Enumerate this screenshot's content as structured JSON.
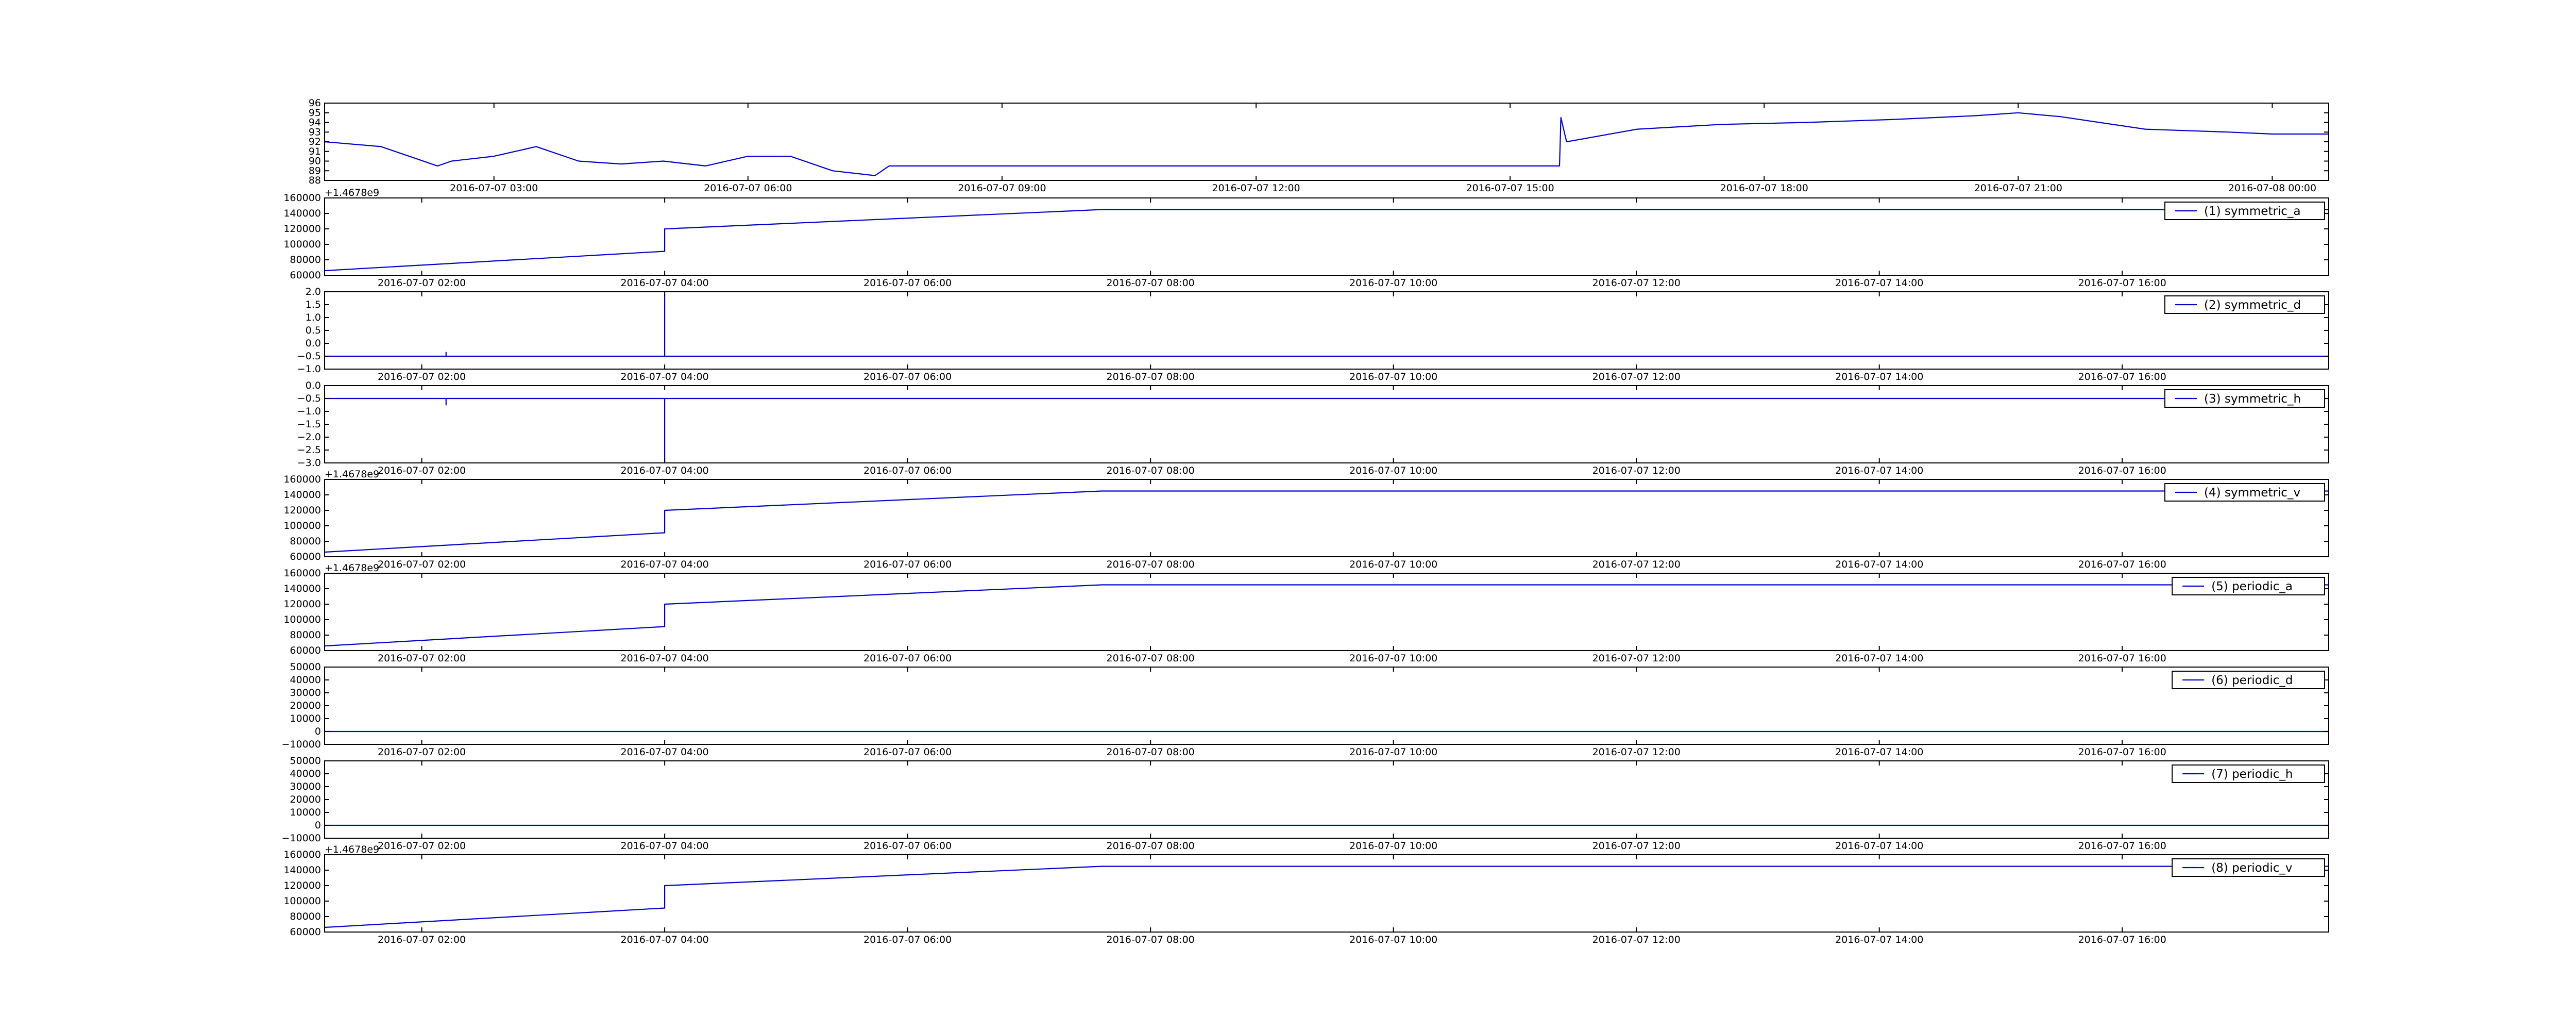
{
  "chart_data": [
    {
      "id": "top",
      "type": "line",
      "series": [
        {
          "color": "#0000cc",
          "x": [
            "2016-07-07 01:00",
            "2016-07-07 01:40",
            "2016-07-07 02:20",
            "2016-07-07 02:30",
            "2016-07-07 03:00",
            "2016-07-07 03:30",
            "2016-07-07 04:00",
            "2016-07-07 04:30",
            "2016-07-07 05:00",
            "2016-07-07 05:30",
            "2016-07-07 06:00",
            "2016-07-07 06:30",
            "2016-07-07 07:00",
            "2016-07-07 07:30",
            "2016-07-07 07:40",
            "2016-07-07 15:35",
            "2016-07-07 15:36",
            "2016-07-07 15:40",
            "2016-07-07 16:30",
            "2016-07-07 17:30",
            "2016-07-07 18:30",
            "2016-07-07 19:30",
            "2016-07-07 20:30",
            "2016-07-07 21:00",
            "2016-07-07 21:30",
            "2016-07-07 22:30",
            "2016-07-07 23:30",
            "2016-07-08 00:00",
            "2016-07-08 00:40"
          ],
          "y": [
            92,
            91.5,
            89.5,
            90,
            90.5,
            91.5,
            90,
            89.7,
            90,
            89.5,
            90.5,
            90.5,
            89,
            88.5,
            89.5,
            89.5,
            94.5,
            92,
            93.3,
            93.8,
            94,
            94.3,
            94.7,
            95,
            94.6,
            93.3,
            93,
            92.8,
            92.8
          ]
        }
      ],
      "xlim": [
        "2016-07-07 01:00",
        "2016-07-08 00:40"
      ],
      "ylim": [
        88,
        96
      ],
      "yticks": [
        "88",
        "89",
        "90",
        "91",
        "92",
        "93",
        "94",
        "95",
        "96"
      ],
      "xticks": [
        "2016-07-07 03:00",
        "2016-07-07 06:00",
        "2016-07-07 09:00",
        "2016-07-07 12:00",
        "2016-07-07 15:00",
        "2016-07-07 18:00",
        "2016-07-07 21:00",
        "2016-07-08 00:00"
      ],
      "offset": "",
      "legend": ""
    },
    {
      "id": "symmetric_a",
      "type": "line",
      "series": [
        {
          "color": "#0000cc",
          "x": [
            1.2,
            4.0,
            4.0,
            7.6,
            17.7
          ],
          "y": [
            66000,
            91000,
            120000,
            145000,
            145000
          ]
        }
      ],
      "xlim": [
        1.2,
        17.7
      ],
      "ylim": [
        60000,
        160000
      ],
      "yticks": [
        "60000",
        "80000",
        "100000",
        "120000",
        "140000",
        "160000"
      ],
      "xticks": [
        "2016-07-07 02:00",
        "2016-07-07 04:00",
        "2016-07-07 06:00",
        "2016-07-07 08:00",
        "2016-07-07 10:00",
        "2016-07-07 12:00",
        "2016-07-07 14:00",
        "2016-07-07 16:00"
      ],
      "offset": "+1.4678e9",
      "legend": "(1) symmetric_a"
    },
    {
      "id": "symmetric_d",
      "type": "line",
      "series": [
        {
          "color": "#0000cc",
          "x": [
            1.2,
            2.2,
            2.2,
            2.2,
            4.0,
            4.0,
            4.0,
            17.7
          ],
          "y": [
            -0.5,
            -0.5,
            -0.35,
            -0.5,
            -0.5,
            1.9,
            -0.5,
            -0.5
          ]
        }
      ],
      "xlim": [
        1.2,
        17.7
      ],
      "ylim": [
        -1.0,
        2.0
      ],
      "yticks": [
        "−1.0",
        "−0.5",
        "0.0",
        "0.5",
        "1.0",
        "1.5",
        "2.0"
      ],
      "xticks": [
        "2016-07-07 02:00",
        "2016-07-07 04:00",
        "2016-07-07 06:00",
        "2016-07-07 08:00",
        "2016-07-07 10:00",
        "2016-07-07 12:00",
        "2016-07-07 14:00",
        "2016-07-07 16:00"
      ],
      "offset": "",
      "legend": "(2) symmetric_d"
    },
    {
      "id": "symmetric_h",
      "type": "line",
      "series": [
        {
          "color": "#0000cc",
          "x": [
            1.2,
            2.2,
            2.2,
            2.2,
            4.0,
            4.0,
            4.0,
            17.7
          ],
          "y": [
            -0.5,
            -0.5,
            -0.75,
            -0.5,
            -0.5,
            -2.95,
            -0.5,
            -0.5
          ]
        }
      ],
      "xlim": [
        1.2,
        17.7
      ],
      "ylim": [
        -3.0,
        0.0
      ],
      "yticks": [
        "−3.0",
        "−2.5",
        "−2.0",
        "−1.5",
        "−1.0",
        "−0.5",
        "0.0"
      ],
      "xticks": [
        "2016-07-07 02:00",
        "2016-07-07 04:00",
        "2016-07-07 06:00",
        "2016-07-07 08:00",
        "2016-07-07 10:00",
        "2016-07-07 12:00",
        "2016-07-07 14:00",
        "2016-07-07 16:00"
      ],
      "offset": "",
      "legend": "(3) symmetric_h"
    },
    {
      "id": "symmetric_v",
      "type": "line",
      "series": [
        {
          "color": "#0000cc",
          "x": [
            1.2,
            4.0,
            4.0,
            7.6,
            17.7
          ],
          "y": [
            66000,
            91000,
            120000,
            145000,
            145000
          ]
        }
      ],
      "xlim": [
        1.2,
        17.7
      ],
      "ylim": [
        60000,
        160000
      ],
      "yticks": [
        "60000",
        "80000",
        "100000",
        "120000",
        "140000",
        "160000"
      ],
      "xticks": [
        "2016-07-07 02:00",
        "2016-07-07 04:00",
        "2016-07-07 06:00",
        "2016-07-07 08:00",
        "2016-07-07 10:00",
        "2016-07-07 12:00",
        "2016-07-07 14:00",
        "2016-07-07 16:00"
      ],
      "offset": "+1.4678e9",
      "legend": "(4) symmetric_v"
    },
    {
      "id": "periodic_a",
      "type": "line",
      "series": [
        {
          "color": "#0000cc",
          "x": [
            1.2,
            4.0,
            4.0,
            7.6,
            17.7
          ],
          "y": [
            66000,
            91000,
            120000,
            145000,
            145000
          ]
        }
      ],
      "xlim": [
        1.2,
        17.7
      ],
      "ylim": [
        60000,
        160000
      ],
      "yticks": [
        "60000",
        "80000",
        "100000",
        "120000",
        "140000",
        "160000"
      ],
      "xticks": [
        "2016-07-07 02:00",
        "2016-07-07 04:00",
        "2016-07-07 06:00",
        "2016-07-07 08:00",
        "2016-07-07 10:00",
        "2016-07-07 12:00",
        "2016-07-07 14:00",
        "2016-07-07 16:00"
      ],
      "offset": "+1.4678e9",
      "legend": "(5) periodic_a"
    },
    {
      "id": "periodic_d",
      "type": "line",
      "series": [
        {
          "color": "#0000cc",
          "x": [
            1.2,
            17.7
          ],
          "y": [
            0,
            0
          ]
        }
      ],
      "xlim": [
        1.2,
        17.7
      ],
      "ylim": [
        -10000,
        50000
      ],
      "yticks": [
        "−10000",
        "0",
        "10000",
        "20000",
        "30000",
        "40000",
        "50000"
      ],
      "xticks": [
        "2016-07-07 02:00",
        "2016-07-07 04:00",
        "2016-07-07 06:00",
        "2016-07-07 08:00",
        "2016-07-07 10:00",
        "2016-07-07 12:00",
        "2016-07-07 14:00",
        "2016-07-07 16:00"
      ],
      "offset": "",
      "legend": "(6) periodic_d"
    },
    {
      "id": "periodic_h",
      "type": "line",
      "series": [
        {
          "color": "#0000cc",
          "x": [
            1.2,
            17.7
          ],
          "y": [
            0,
            0
          ]
        }
      ],
      "xlim": [
        1.2,
        17.7
      ],
      "ylim": [
        -10000,
        50000
      ],
      "yticks": [
        "−10000",
        "0",
        "10000",
        "20000",
        "30000",
        "40000",
        "50000"
      ],
      "xticks": [
        "2016-07-07 02:00",
        "2016-07-07 04:00",
        "2016-07-07 06:00",
        "2016-07-07 08:00",
        "2016-07-07 10:00",
        "2016-07-07 12:00",
        "2016-07-07 14:00",
        "2016-07-07 16:00"
      ],
      "offset": "",
      "legend": "(7) periodic_h"
    },
    {
      "id": "periodic_v",
      "type": "line",
      "series": [
        {
          "color": "#0000cc",
          "x": [
            1.2,
            4.0,
            4.0,
            7.6,
            17.7
          ],
          "y": [
            66000,
            91000,
            120000,
            145000,
            145000
          ]
        }
      ],
      "xlim": [
        1.2,
        17.7
      ],
      "ylim": [
        60000,
        160000
      ],
      "yticks": [
        "60000",
        "80000",
        "100000",
        "120000",
        "140000",
        "160000"
      ],
      "xticks": [
        "2016-07-07 02:00",
        "2016-07-07 04:00",
        "2016-07-07 06:00",
        "2016-07-07 08:00",
        "2016-07-07 10:00",
        "2016-07-07 12:00",
        "2016-07-07 14:00",
        "2016-07-07 16:00"
      ],
      "offset": "+1.4678e9",
      "legend": "(8) periodic_v"
    }
  ]
}
